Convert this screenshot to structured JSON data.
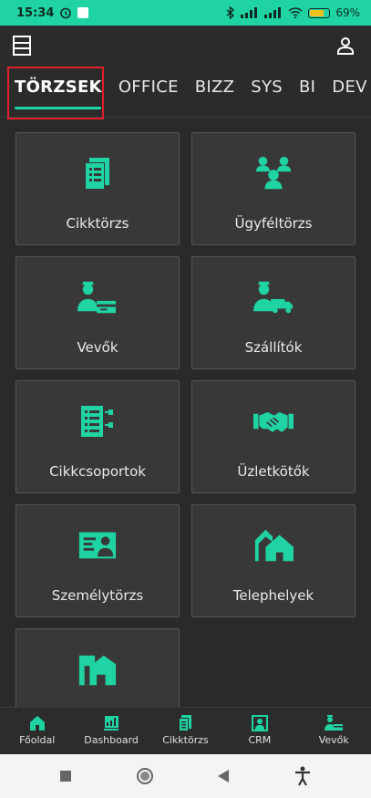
{
  "status_bar": {
    "time": "15:34",
    "battery": "69%"
  },
  "tabs": [
    {
      "label": "TÖRZSEK",
      "active": true
    },
    {
      "label": "OFFICE"
    },
    {
      "label": "BIZZ"
    },
    {
      "label": "SYS"
    },
    {
      "label": "BI"
    },
    {
      "label": "DEV"
    }
  ],
  "tiles": [
    {
      "label": "Cikktörzs",
      "icon": "document-list-icon"
    },
    {
      "label": "Ügyféltörzs",
      "icon": "customer-group-icon"
    },
    {
      "label": "Vevők",
      "icon": "buyer-card-icon"
    },
    {
      "label": "Szállítók",
      "icon": "supplier-truck-icon"
    },
    {
      "label": "Cikkcsoportok",
      "icon": "item-groups-icon"
    },
    {
      "label": "Üzletkötők",
      "icon": "handshake-icon"
    },
    {
      "label": "Személytörzs",
      "icon": "id-card-icon"
    },
    {
      "label": "Telephelyek",
      "icon": "buildings-icon"
    },
    {
      "label": "",
      "icon": "warehouse-icon"
    }
  ],
  "bottom_nav": [
    {
      "label": "Főoldal",
      "icon": "home-icon"
    },
    {
      "label": "Dashboard",
      "icon": "dashboard-icon"
    },
    {
      "label": "Cikktörzs",
      "icon": "document-list-icon"
    },
    {
      "label": "CRM",
      "icon": "crm-icon"
    },
    {
      "label": "Vevők",
      "icon": "buyer-card-icon"
    }
  ],
  "colors": {
    "accent": "#1fd4a2",
    "tile_bg": "#383838",
    "app_bg": "#2a2a2a",
    "highlight": "#e0202a"
  }
}
